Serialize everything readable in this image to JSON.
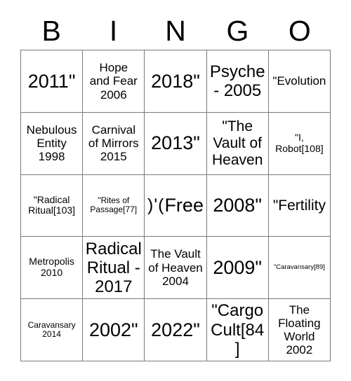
{
  "card": {
    "title": "Bingo Card",
    "header_letters": [
      "B",
      "I",
      "N",
      "G",
      "O"
    ],
    "colors": {
      "background": "#ffffff",
      "text": "#000000",
      "grid_line": "#7a7a7a"
    },
    "grid": {
      "columns": 5,
      "rows": 5,
      "free_space": {
        "row": 3,
        "column": 3,
        "symbol": ")'(",
        "label": "Free"
      }
    },
    "rows": [
      [
        {
          "text": "2011\"",
          "size": "xxl"
        },
        {
          "text": "Hope\nand Fear\n2006",
          "size": "md"
        },
        {
          "text": "2018\"",
          "size": "xxl"
        },
        {
          "text": "Psyche\n- 2005",
          "size": "xl"
        },
        {
          "text": "\"Evolution",
          "size": "md"
        }
      ],
      [
        {
          "text": "Nebulous\nEntity\n1998",
          "size": "md"
        },
        {
          "text": "Carnival\nof Mirrors\n2015",
          "size": "md"
        },
        {
          "text": "2013\"",
          "size": "xxl"
        },
        {
          "text": "\"The\nVault of\nHeaven",
          "size": "lg"
        },
        {
          "text": "\"I,\nRobot[108]",
          "size": "sm"
        }
      ],
      [
        {
          "text": "\"Radical\nRitual[103]",
          "size": "sm"
        },
        {
          "text": "\"Rites of\nPassage[77]",
          "size": "xs"
        },
        {
          "text": ")'(\nFree",
          "size": "free"
        },
        {
          "text": "2008\"",
          "size": "xxl"
        },
        {
          "text": "\"Fertility",
          "size": "lg"
        }
      ],
      [
        {
          "text": "Metropolis\n2010",
          "size": "sm"
        },
        {
          "text": "Radical\nRitual -\n2017",
          "size": "xl"
        },
        {
          "text": "The Vault\nof Heaven\n2004",
          "size": "md"
        },
        {
          "text": "2009\"",
          "size": "xxl"
        },
        {
          "text": "\"Caravansary[89]",
          "size": "xxs"
        }
      ],
      [
        {
          "text": "Caravansary\n2014",
          "size": "xs"
        },
        {
          "text": "2002\"",
          "size": "xxl"
        },
        {
          "text": "2022\"",
          "size": "xxl"
        },
        {
          "text": "\"Cargo\nCult[84]",
          "size": "xl"
        },
        {
          "text": "The\nFloating\nWorld\n2002",
          "size": "md"
        }
      ]
    ]
  }
}
